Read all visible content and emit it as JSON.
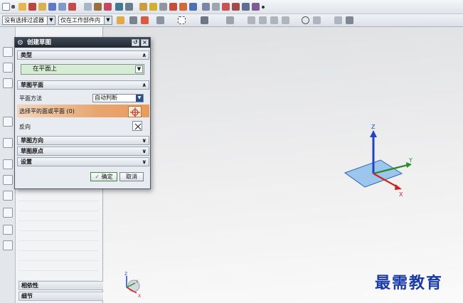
{
  "toolbar": {
    "filter_select": "没有选择过滤器",
    "scope_select": "仅在工作部件内"
  },
  "dialog": {
    "title": "创建草图",
    "type_group": {
      "label": "类型",
      "value": "在平面上"
    },
    "plane_group": {
      "label": "草图平面",
      "method_label": "平面方法",
      "method_value": "自动判断",
      "select_label": "选择平的面或平面 (0)",
      "reverse_label": "反向"
    },
    "orientation_group": {
      "label": "草图方向"
    },
    "origin_group": {
      "label": "草图原点"
    },
    "settings_group": {
      "label": "设置"
    },
    "ok_label": "确定",
    "cancel_label": "取消"
  },
  "navigator": {
    "dependencies_label": "相依性",
    "details_label": "细节"
  },
  "csys": {
    "x": "X",
    "y": "Y",
    "z": "Z"
  },
  "mini_triad": {
    "x": "X",
    "y": "Y",
    "z": "Z"
  },
  "watermark": "最需教育",
  "colors": {
    "dialog_title_bg": "#2a323d",
    "type_field_bg": "#d6ecd5",
    "selection_row_accent": "#e89c5d",
    "x_axis": "#d11f1f",
    "y_axis": "#2b8a2b",
    "z_axis": "#1f44c6",
    "plane_fill": "#7ab5ea",
    "watermark": "#1a3aa8"
  }
}
